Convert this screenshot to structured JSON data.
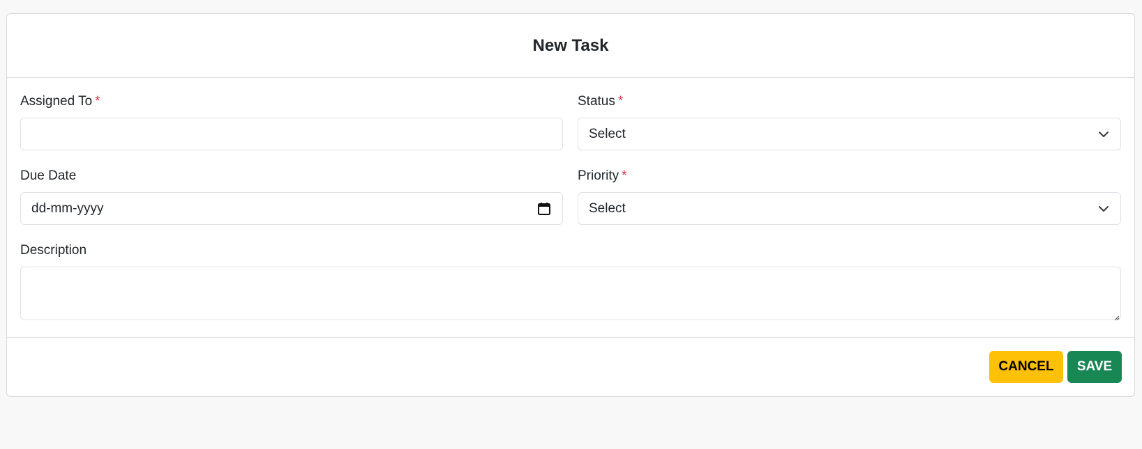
{
  "form": {
    "title": "New Task",
    "assigned_to": {
      "label": "Assigned To",
      "required_mark": "*",
      "value": ""
    },
    "status": {
      "label": "Status",
      "required_mark": "*",
      "selected": "Select"
    },
    "due_date": {
      "label": "Due Date",
      "placeholder": "dd-mm-yyyy"
    },
    "priority": {
      "label": "Priority",
      "required_mark": "*",
      "selected": "Select"
    },
    "description": {
      "label": "Description",
      "value": ""
    }
  },
  "footer": {
    "cancel_label": "CANCEL",
    "save_label": "SAVE"
  },
  "icons": {
    "status_dropdown": "chevron-down-icon",
    "priority_dropdown": "chevron-down-icon",
    "due_date_picker": "calendar-icon",
    "description_resize": "resize-grip-icon"
  },
  "colors": {
    "required": "#dc3545",
    "cancel_button": "#ffc107",
    "save_button": "#198754"
  }
}
